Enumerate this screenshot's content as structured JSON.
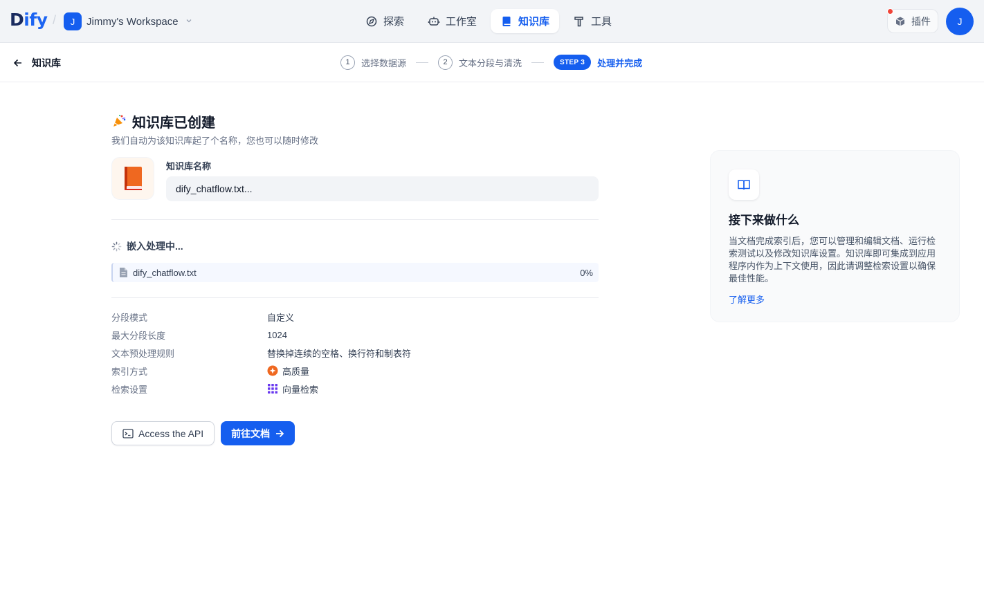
{
  "app": {
    "logo_text_1": "D",
    "logo_text_2": "ify"
  },
  "workspace": {
    "initial": "J",
    "name": "Jimmy's Workspace"
  },
  "nav": [
    {
      "label": "探索",
      "icon": "explore-icon"
    },
    {
      "label": "工作室",
      "icon": "robot-icon"
    },
    {
      "label": "知识库",
      "icon": "book-icon",
      "active": true
    },
    {
      "label": "工具",
      "icon": "hammer-icon"
    }
  ],
  "plugins": {
    "label": "插件"
  },
  "user": {
    "initial": "J"
  },
  "stepbar": {
    "back_label": "知识库",
    "steps": [
      {
        "num": "1",
        "label": "选择数据源"
      },
      {
        "num": "2",
        "label": "文本分段与清洗"
      },
      {
        "num": "STEP 3",
        "label": "处理并完成",
        "active": true
      }
    ]
  },
  "main": {
    "title": "知识库已创建",
    "subtitle": "我们自动为该知识库起了个名称，您也可以随时修改",
    "name_label": "知识库名称",
    "name_value": "dify_chatflow.txt...",
    "embed_title": "嵌入处理中...",
    "file": {
      "name": "dify_chatflow.txt",
      "progress": "0%"
    },
    "info": [
      {
        "key": "分段模式",
        "value": "自定义"
      },
      {
        "key": "最大分段长度",
        "value": "1024"
      },
      {
        "key": "文本预处理规则",
        "value": "替换掉连续的空格、换行符和制表符"
      },
      {
        "key": "索引方式",
        "value": "高质量",
        "icon": "high-quality-icon"
      },
      {
        "key": "检索设置",
        "value": "向量检索",
        "icon": "vector-search-icon"
      }
    ],
    "api_button": "Access the API",
    "doc_button": "前往文档"
  },
  "card": {
    "title": "接下来做什么",
    "description": "当文档完成索引后，您可以管理和编辑文档、运行检索测试以及修改知识库设置。知识库即可集成到应用程序内作为上下文使用，因此请调整检索设置以确保最佳性能。",
    "link": "了解更多"
  },
  "colors": {
    "primary": "#155eef",
    "notification": "#f04438"
  }
}
